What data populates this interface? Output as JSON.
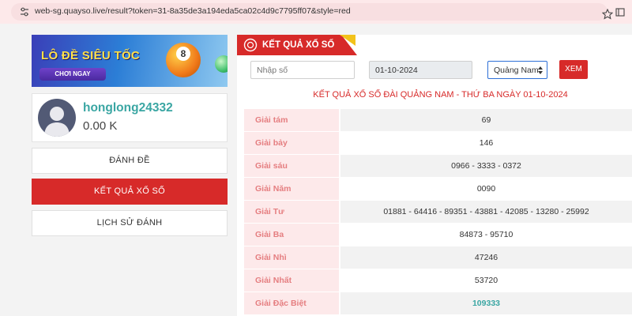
{
  "browser": {
    "url": "web-sg.quayso.live/result?token=31-8a35de3a194eda5ca02c4d9c7795ff07&style=red"
  },
  "banner": {
    "title": "LÔ ĐỀ SIÊU TỐC",
    "button_label": "CHƠI NGAY",
    "ball_number": "8"
  },
  "user": {
    "username": "honglong24332",
    "balance": "0.00 K"
  },
  "menu": {
    "items": [
      {
        "label": "ĐÁNH ĐỀ",
        "active": false
      },
      {
        "label": "KẾT QUẢ XỔ SỐ",
        "active": true
      },
      {
        "label": "LỊCH SỬ ĐÁNH",
        "active": false
      }
    ]
  },
  "panel": {
    "tab_title": "KẾT QUẢ XỔ SỐ",
    "search_placeholder": "Nhập số",
    "date_value": "01-10-2024",
    "province_selected": "Quảng Nam",
    "submit_label": "XEM",
    "result_title": "KẾT QUẢ XỔ SỐ ĐÀI QUẢNG NAM - THỨ BA NGÀY 01-10-2024"
  },
  "results": [
    {
      "label": "Giải tám",
      "value": "69"
    },
    {
      "label": "Giải bảy",
      "value": "146"
    },
    {
      "label": "Giải sáu",
      "value": "0966 - 3333 - 0372"
    },
    {
      "label": "Giải Năm",
      "value": "0090"
    },
    {
      "label": "Giải Tư",
      "value": "01881 - 64416 - 89351 - 43881 - 42085 - 13280 - 25992"
    },
    {
      "label": "Giải Ba",
      "value": "84873 - 95710"
    },
    {
      "label": "Giải Nhì",
      "value": "47246"
    },
    {
      "label": "Giải Nhất",
      "value": "53720"
    },
    {
      "label": "Giải Đặc Biệt",
      "value": "109333"
    }
  ],
  "colors": {
    "accent_red": "#d72a29",
    "label_bg": "#fde9ea",
    "label_text": "#e57e80",
    "teal": "#3aa6a3"
  }
}
